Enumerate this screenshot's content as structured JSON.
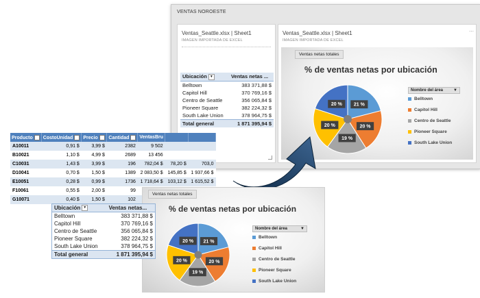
{
  "dashboard": {
    "title": "VENTAS NOROESTE",
    "tile_left": {
      "title": "Ventas_Seattle.xlsx | Sheet1",
      "subtitle": "IMAGEN IMPORTADA DE EXCEL"
    },
    "tile_right": {
      "title": "Ventas_Seattle.xlsx | Sheet1",
      "subtitle": "IMAGEN IMPORTADA DE EXCEL"
    }
  },
  "pivot": {
    "headers": [
      "Ubicación",
      "Ventas netas ...",
      "Ventas netas..."
    ],
    "rows": [
      {
        "name": "Belltown",
        "value": "383 371,88 $"
      },
      {
        "name": "Capitol Hill",
        "value": "370 769,16 $"
      },
      {
        "name": "Centro de Seattle",
        "value": "356 065,84 $"
      },
      {
        "name": "Pioneer Square",
        "value": "382 224,32 $"
      },
      {
        "name": "South Lake Union",
        "value": "378 964,75 $"
      }
    ],
    "total_label": "Total general",
    "total_value": "1 871 395,94 $"
  },
  "excel_table": {
    "headers": [
      "Producto",
      "CostoUnidad",
      "Precio",
      "Cantidad",
      "VentasBru"
    ],
    "rows": [
      [
        "A10011",
        "0,91 $",
        "3,99 $",
        "2382",
        "9 502"
      ],
      [
        "B10021",
        "1,10 $",
        "4,99 $",
        "2689",
        "13 456"
      ],
      [
        "C10031",
        "1,43 $",
        "3,99 $",
        "196",
        "782,04 $",
        "78,20 $",
        "703,0"
      ],
      [
        "D10041",
        "0,70 $",
        "1,50 $",
        "1389",
        "2 083,50 $",
        "145,85 $",
        "1 937,66 $"
      ],
      [
        "E10051",
        "0,28 $",
        "0,99 $",
        "1736",
        "1 718,64 $",
        "103,12 $",
        "1 615,52 $"
      ],
      [
        "F10061",
        "0,55 $",
        "2,00 $",
        "99",
        "",
        "",
        ""
      ],
      [
        "G10071",
        "0,40 $",
        "1,50 $",
        "102",
        "",
        "",
        ""
      ]
    ]
  },
  "chart": {
    "field_button": "Ventas netas totales",
    "title": "% de ventas netas por ubicación",
    "legend_title": "Nombre del área",
    "slice_labels": [
      "21 %",
      "20 %",
      "19 %",
      "20 %",
      "20 %"
    ]
  },
  "chart_data": {
    "type": "pie",
    "title": "% de ventas netas por ubicación",
    "categories": [
      "Belltown",
      "Capitol Hill",
      "Centro de Seattle",
      "Pioneer Square",
      "South Lake Union"
    ],
    "values": [
      21,
      20,
      19,
      20,
      20
    ],
    "colors": [
      "#5b9bd5",
      "#ed7d31",
      "#a5a5a5",
      "#ffc000",
      "#4472c4"
    ],
    "legend_position": "right"
  },
  "colors": {
    "excel_header": "#4f81bd",
    "arrow": "#1f3b5a"
  }
}
